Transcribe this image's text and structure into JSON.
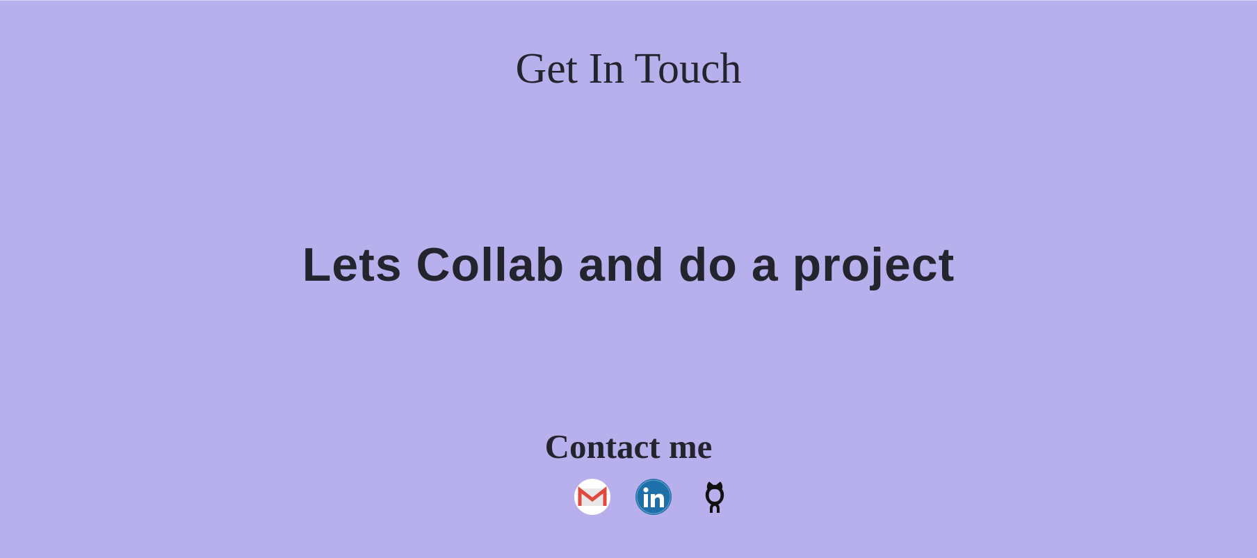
{
  "header": {
    "title": "Get In Touch"
  },
  "main": {
    "headline": "Lets Collab and do a project"
  },
  "contact": {
    "heading": "Contact me",
    "links": [
      {
        "icon": "gmail-icon",
        "label": "Gmail"
      },
      {
        "icon": "linkedin-icon",
        "label": "LinkedIn"
      },
      {
        "icon": "github-icon",
        "label": "GitHub"
      }
    ]
  },
  "colors": {
    "background": "#b8b0ec",
    "text": "#24242e",
    "gmail_red": "#e04a3e",
    "linkedin_blue": "#1f6fa8"
  }
}
